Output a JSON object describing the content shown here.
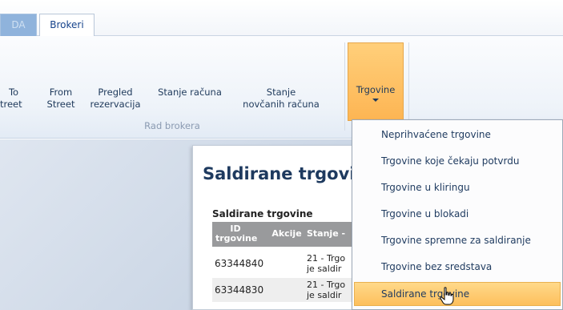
{
  "tabs": [
    {
      "label": "DA"
    },
    {
      "label": "Brokeri"
    }
  ],
  "ribbon": {
    "buttons": [
      {
        "line1": "To",
        "line2": "treet"
      },
      {
        "line1": "From",
        "line2": "Street"
      },
      {
        "line1": "Pregled",
        "line2": "rezervacija"
      },
      {
        "line1": "Stanje računa",
        "line2": ""
      },
      {
        "line1": "Stanje",
        "line2": "novčanih računa"
      }
    ],
    "group_label": "Rad brokera",
    "trgovine_button": "Trgovine"
  },
  "menu": {
    "items": [
      {
        "label": "Neprihvaćene trgovine"
      },
      {
        "label": "Trgovine koje čekaju potvrdu"
      },
      {
        "label": "Trgovine u kliringu"
      },
      {
        "label": "Trgovine u blokadi"
      },
      {
        "label": "Trgovine spremne za saldiranje"
      },
      {
        "label": "Trgovine bez sredstava"
      },
      {
        "label": "Saldirane trgovine"
      }
    ],
    "highlighted_index": 6
  },
  "document": {
    "title": "Saldirane trgovi",
    "section_title": "Saldirane trgovine",
    "columns": [
      "ID trgovine",
      "Akcije",
      "Stanje -"
    ],
    "rows": [
      {
        "id": "63344840",
        "status_line1": "21 - Trgo",
        "status_line2": "je saldir"
      },
      {
        "id": "63344830",
        "status_line1": "21 - Trgo",
        "status_line2": "je saldir"
      }
    ]
  },
  "colors": {
    "accent_orange": "#fdb553",
    "ribbon_text": "#1e395b",
    "table_header": "#999a9c"
  }
}
